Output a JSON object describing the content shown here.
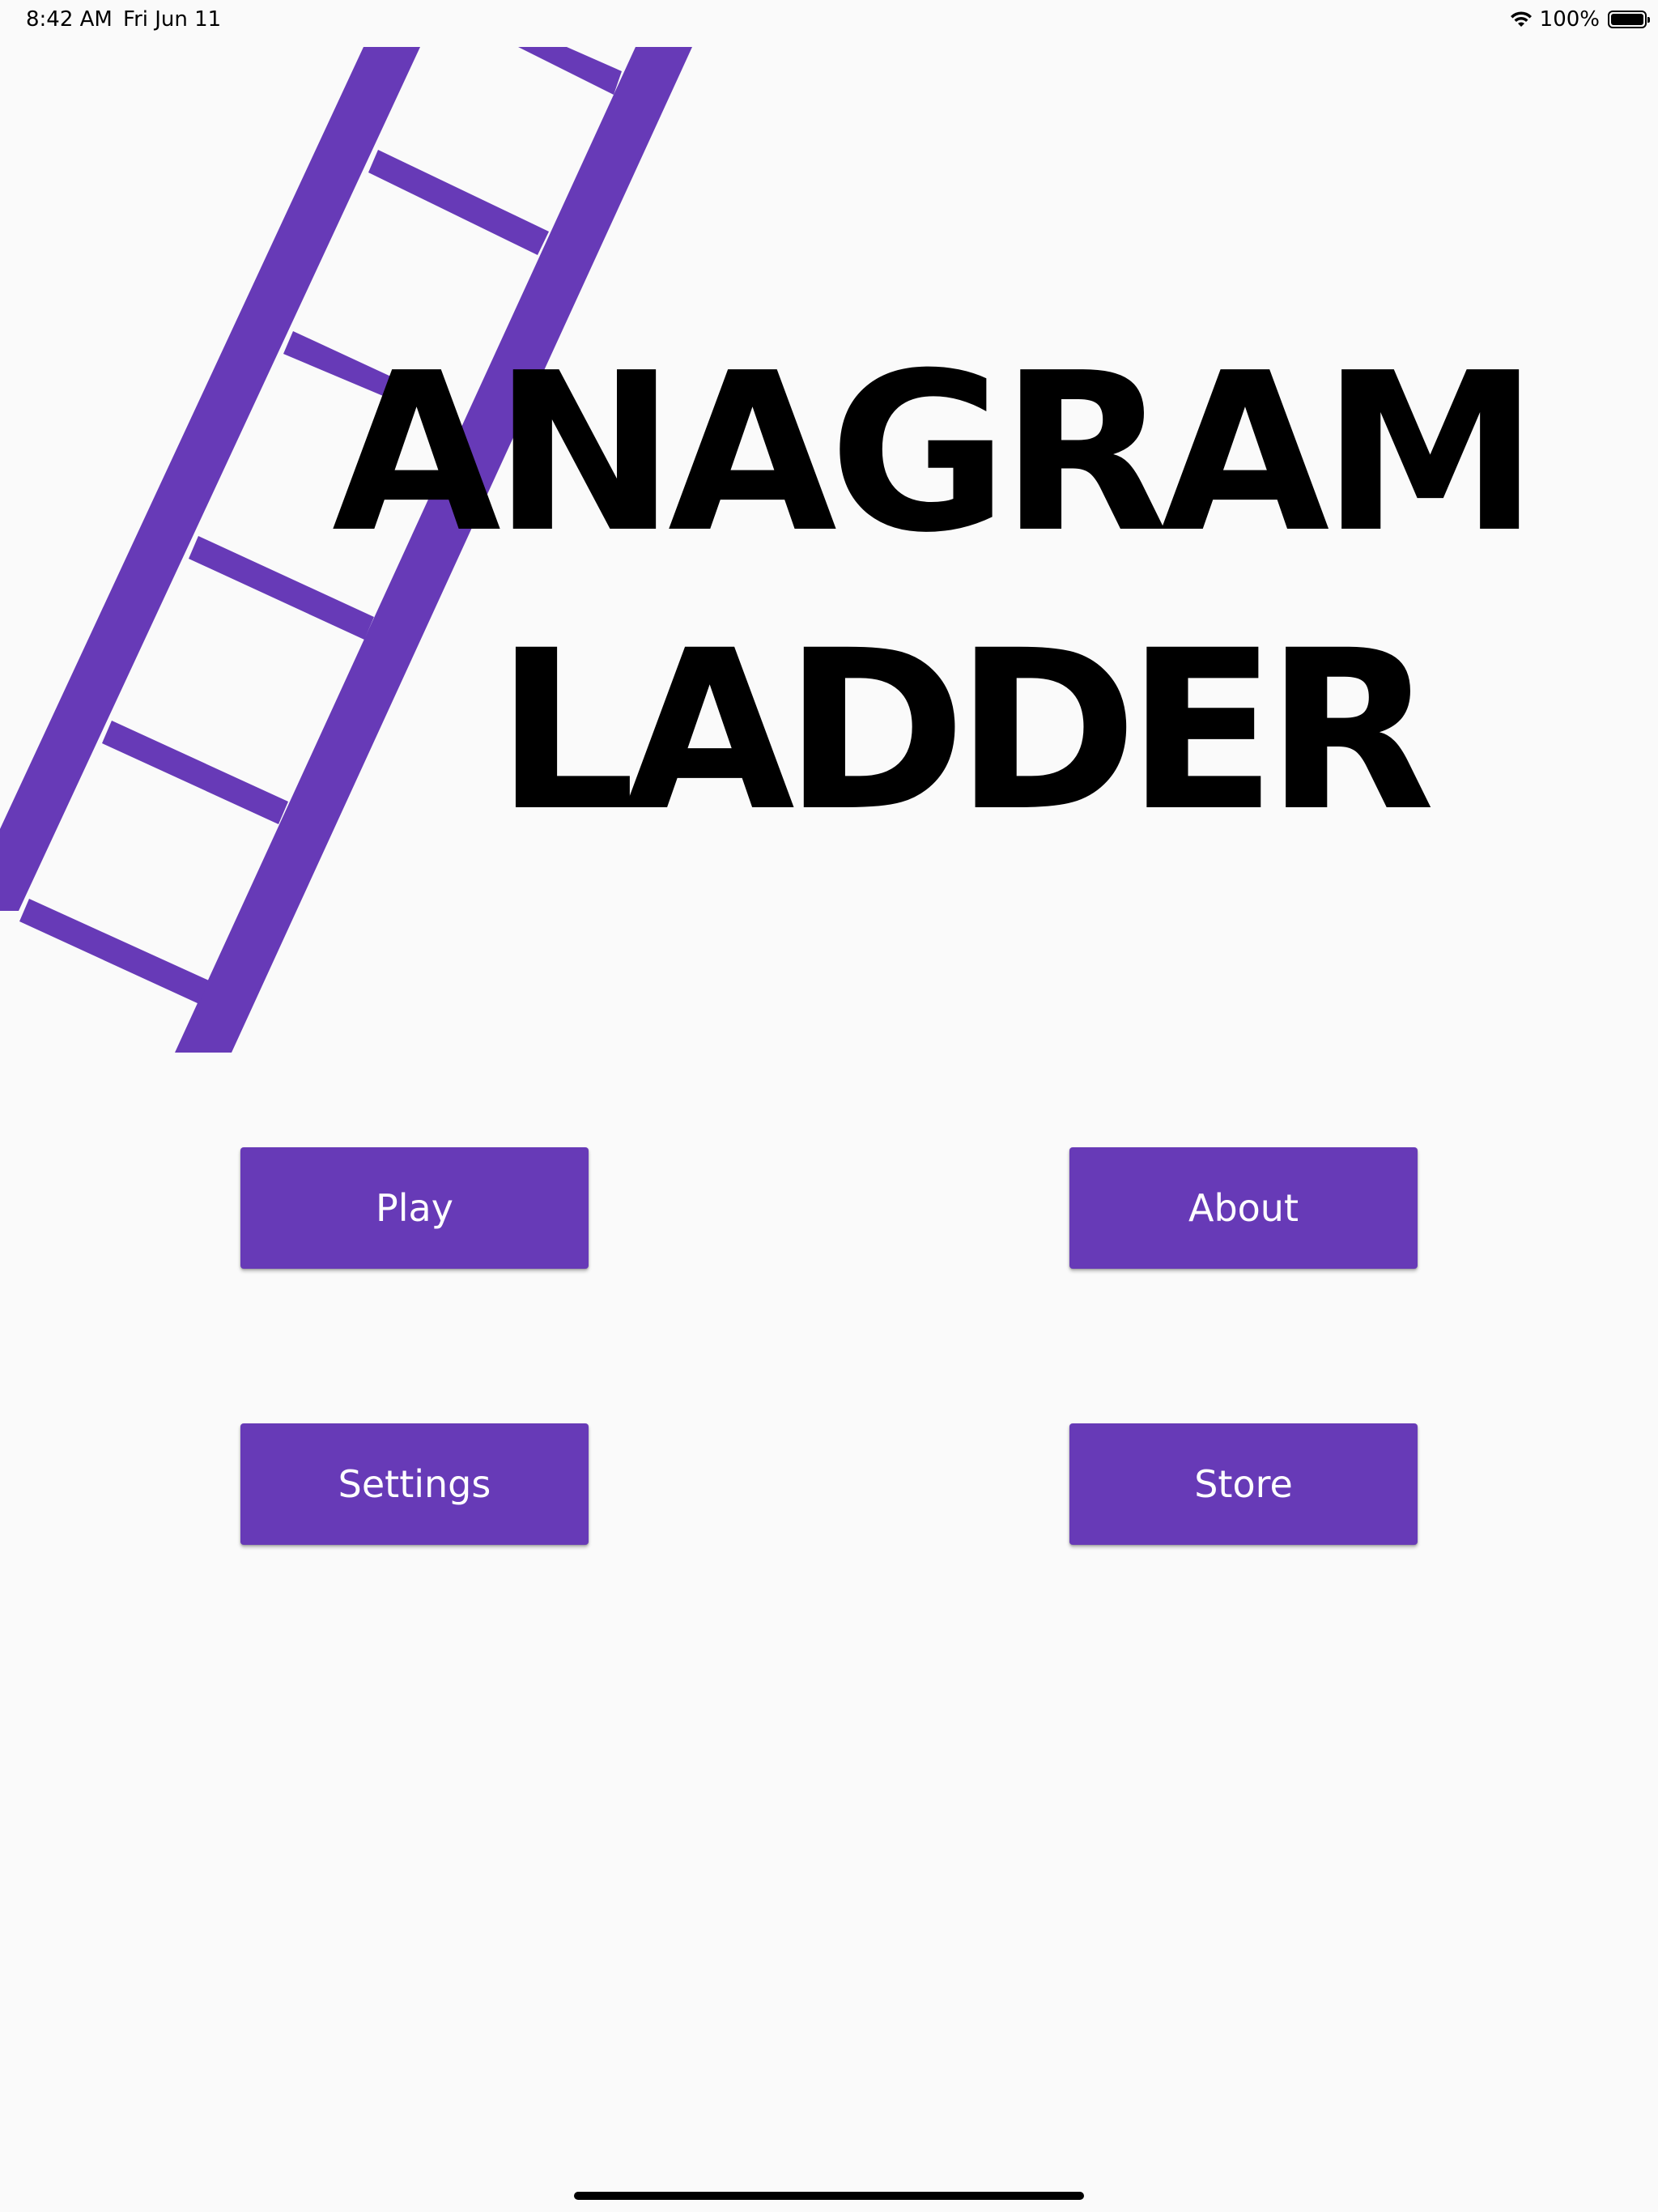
{
  "status_bar": {
    "time": "8:42 AM",
    "date": "Fri Jun 11",
    "battery": "100%",
    "icons": [
      "wifi-icon",
      "battery-icon"
    ]
  },
  "title": {
    "line1": "ANAGRAM",
    "line2": "LADDER"
  },
  "menu": {
    "play_label": "Play",
    "about_label": "About",
    "settings_label": "Settings",
    "store_label": "Store"
  },
  "colors": {
    "accent": "#673ab7",
    "background": "#fafafa",
    "title_text": "#000000",
    "button_text": "#ffffff"
  }
}
